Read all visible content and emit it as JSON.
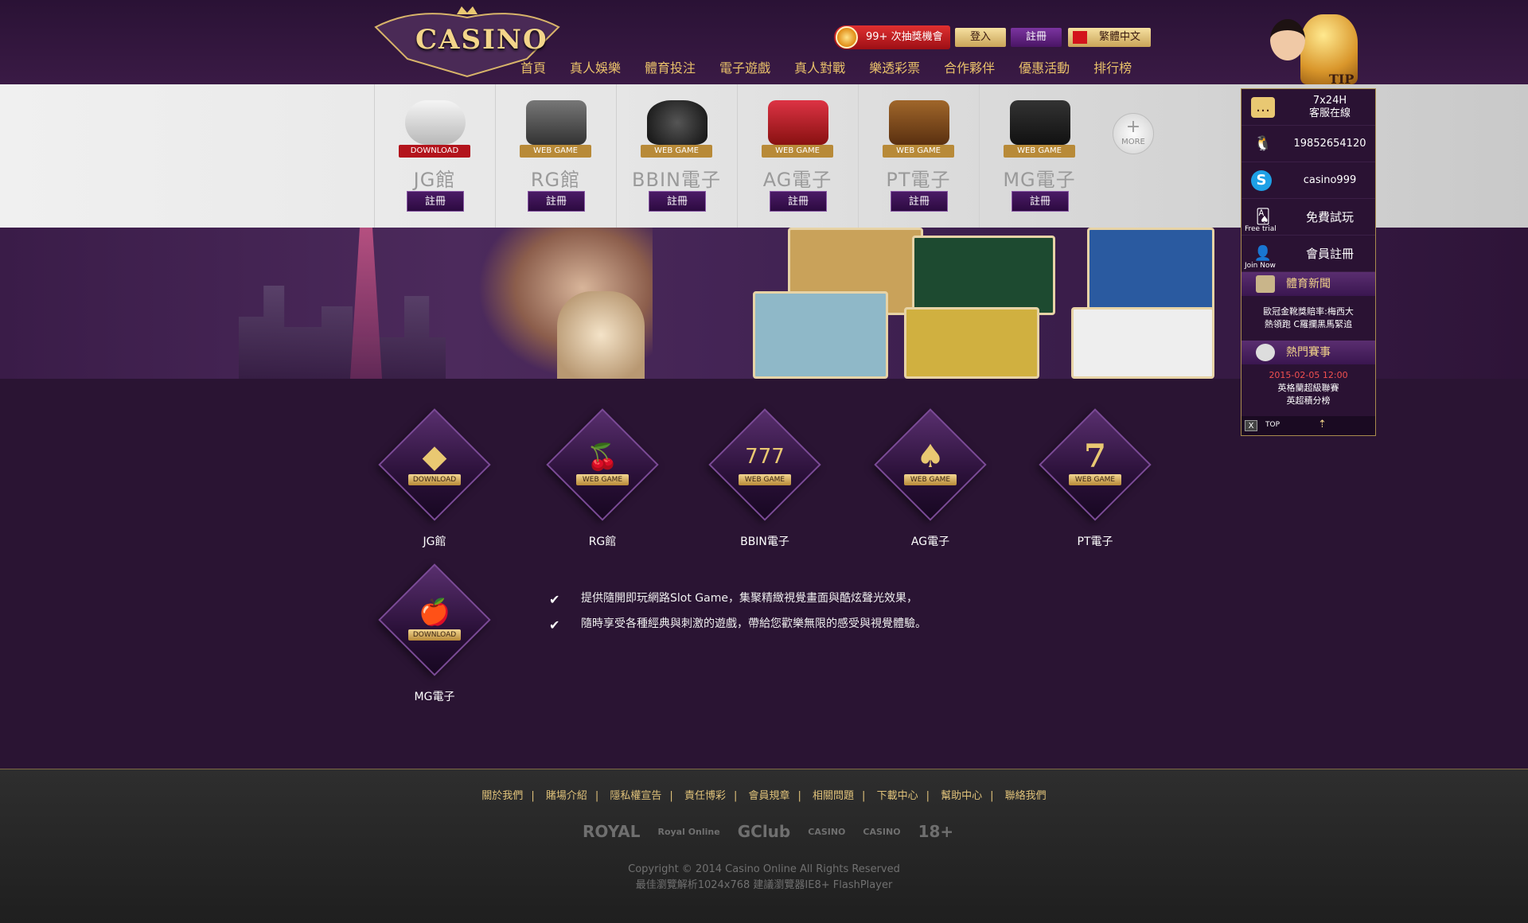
{
  "brand": {
    "logo_text": "CASINO"
  },
  "header": {
    "prize_label": "99+ 次抽獎機會",
    "login_label": "登入",
    "register_label": "註冊",
    "language_label": "繁體中文",
    "nav": [
      "首頁",
      "真人娛樂",
      "體育投注",
      "電子遊戲",
      "真人對戰",
      "樂透彩票",
      "合作夥伴",
      "優惠活動",
      "排行榜"
    ]
  },
  "game_strip": {
    "items": [
      {
        "name": "JG館",
        "tag": "DOWNLOAD",
        "register": "註冊",
        "icon": "gamepad-icon"
      },
      {
        "name": "RG館",
        "tag": "WEB GAME",
        "register": "註冊",
        "icon": "slot-machine-icon"
      },
      {
        "name": "BBIN電子",
        "tag": "WEB GAME",
        "register": "註冊",
        "icon": "money-bag-icon"
      },
      {
        "name": "AG電子",
        "tag": "WEB GAME",
        "register": "註冊",
        "icon": "777-slot-icon"
      },
      {
        "name": "PT電子",
        "tag": "WEB GAME",
        "register": "註冊",
        "icon": "treasure-chest-icon"
      },
      {
        "name": "MG電子",
        "tag": "WEB GAME",
        "register": "註冊",
        "icon": "arcade-icon"
      }
    ],
    "more_label": "MORE"
  },
  "game_grid": {
    "items": [
      {
        "name": "JG館",
        "tag": "DOWNLOAD",
        "glyph": "◆",
        "icon": "diamond-icon"
      },
      {
        "name": "RG館",
        "tag": "WEB GAME",
        "glyph": "🍒",
        "icon": "cherry-icon"
      },
      {
        "name": "BBIN電子",
        "tag": "WEB GAME",
        "glyph": "777",
        "icon": "slot-777-icon"
      },
      {
        "name": "AG電子",
        "tag": "WEB GAME",
        "glyph": "♠",
        "icon": "spade-icon"
      },
      {
        "name": "PT電子",
        "tag": "WEB GAME",
        "glyph": "7",
        "icon": "seven-icon"
      },
      {
        "name": "MG電子",
        "tag": "DOWNLOAD",
        "glyph": "🍎",
        "icon": "apple-icon"
      }
    ],
    "features": [
      "提供隨開即玩網路Slot Game，集聚精緻視覺畫面與酷炫聲光效果，",
      "隨時享受各種經典與刺激的遊戲，帶給您歡樂無限的感受與視覺體驗。"
    ]
  },
  "footer": {
    "links": [
      "關於我們",
      "賭場介紹",
      "隱私權宣告",
      "責任博彩",
      "會員規章",
      "相關問題",
      "下載中心",
      "幫助中心",
      "聯絡我們"
    ],
    "partners": [
      "ROYAL",
      "Royal Online",
      "GClub",
      "CASINO",
      "CASINO",
      "18+"
    ],
    "copyright": "Copyright © 2014 Casino Online All Rights Reserved",
    "browser_note": "最佳瀏覽解析1024x768 建議瀏覽器IE8+ FlashPlayer"
  },
  "side_widget": {
    "tip_label": "TIP",
    "service_line1": "7x24H",
    "service_line2": "客服在線",
    "qq": "19852654120",
    "skype": "casino999",
    "free_trial_small": "Free trial",
    "free_trial": "免費試玩",
    "join_small": "Join Now",
    "join": "會員註冊",
    "sports_news_title": "體育新聞",
    "news_line1": "歐冠金靴獎賠率:梅西大",
    "news_line2": "熱領跑 C羅攔黑馬緊追",
    "hot_events_title": "熱門賽事",
    "event_date": "2015-02-05 12:00",
    "event_line1": "英格蘭超級聯賽",
    "event_line2": "英超積分榜",
    "close_label": "X",
    "top_label": "TOP"
  },
  "colors": {
    "nav_gold": "#e8c06a",
    "bg_purple": "#2a1433",
    "register_purple": "#4b1b66",
    "prize_red": "#d02226"
  }
}
